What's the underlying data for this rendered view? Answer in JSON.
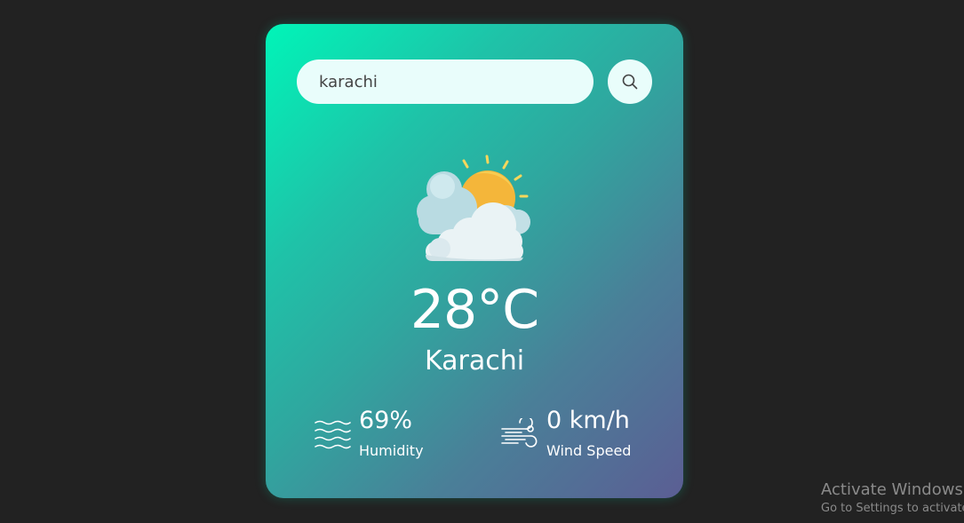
{
  "search": {
    "value": "karachi",
    "button_icon": "search-icon"
  },
  "weather": {
    "icon": "partly-cloudy-sun-icon",
    "temperature": "28°C",
    "city": "Karachi"
  },
  "details": {
    "humidity": {
      "icon": "humidity-waves-icon",
      "value": "69%",
      "label": "Humidity"
    },
    "wind": {
      "icon": "wind-icon",
      "value": "0 km/h",
      "label": "Wind Speed"
    }
  },
  "watermark": {
    "title": "Activate Windows",
    "subtitle": "Go to Settings to activate Windows."
  },
  "colors": {
    "page_background": "#222222",
    "card_gradient_start": "#00f5b8",
    "card_gradient_end": "#5b5e94",
    "input_background": "#e9fdfb",
    "text": "#ffffff"
  }
}
